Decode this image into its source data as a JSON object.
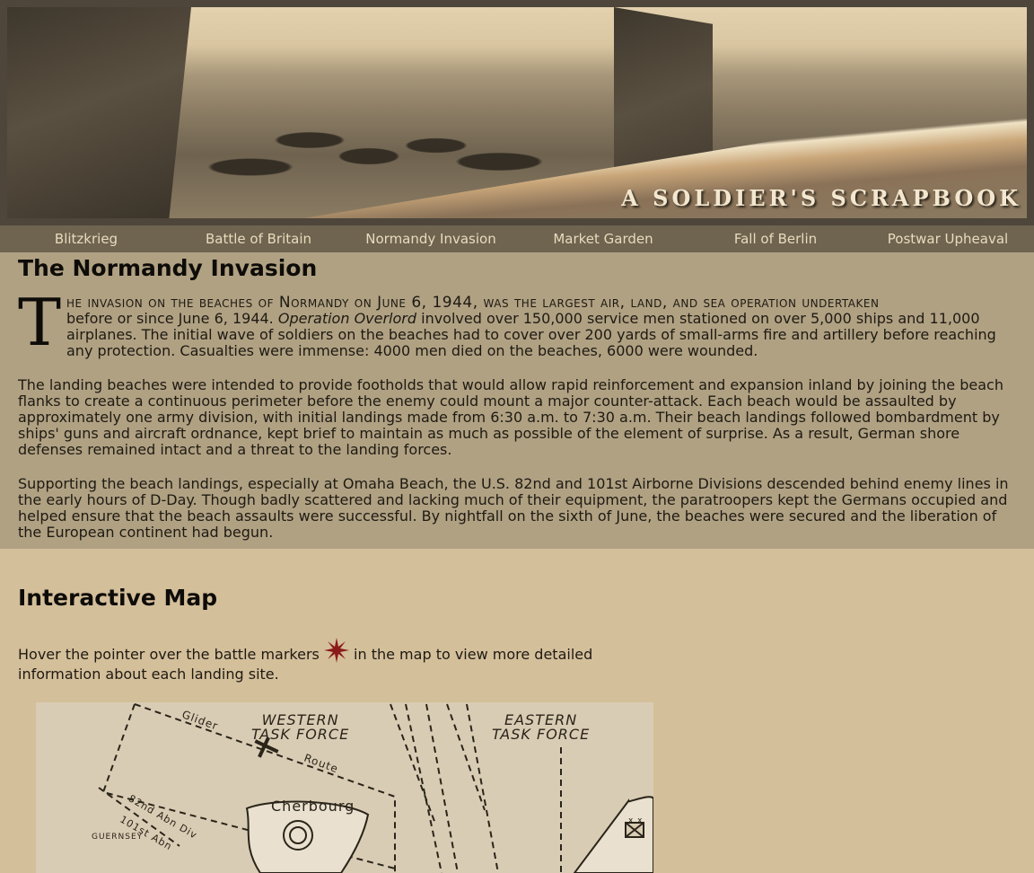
{
  "banner": {
    "title": "A SOLDIER'S SCRAPBOOK"
  },
  "nav": {
    "items": [
      {
        "label": "Blitzkrieg"
      },
      {
        "label": "Battle of Britain"
      },
      {
        "label": "Normandy Invasion"
      },
      {
        "label": "Market Garden"
      },
      {
        "label": "Fall of Berlin"
      },
      {
        "label": "Postwar Upheaval"
      }
    ]
  },
  "article": {
    "title": "The Normandy Invasion",
    "dropcap": "T",
    "lead_smallcaps": "he invasion on the beaches of Normandy on June 6, 1944, was the largest air, land, and sea operation undertaken",
    "lead_line2_pre": "before or since June 6, 1944. ",
    "lead_italic": "Operation Overlord",
    "lead_rest": " involved over 150,000 service men stationed on over 5,000 ships and 11,000 airplanes. The initial wave of soldiers on the beaches had to cover over 200 yards of small-arms fire and artillery before reaching any protection. Casualties were immense: 4000 men died on the beaches, 6000 were wounded.",
    "para2": "The landing beaches were intended to provide footholds that would allow rapid reinforcement and expansion inland by joining the beach flanks to create a continuous perimeter before the enemy could mount a major counter-attack. Each beach would be assaulted by approximately one army division, with initial landings made from 6:30 a.m. to 7:30 a.m. Their beach landings followed bombardment by ships' guns and aircraft ordnance, kept brief to maintain as much as possible of the element of surprise. As a result, German shore defenses remained intact and a threat to the landing forces.",
    "para3": "Supporting the beach landings, especially at Omaha Beach, the U.S. 82nd and 101st Airborne Divisions descended behind enemy lines in the early hours of D-Day. Though badly scattered and lacking much of their equipment, the paratroopers kept the Germans occupied and helped ensure that the beach assaults were successful. By nightfall on the sixth of June, the beaches were secured and the liberation of the European continent had begun."
  },
  "map_section": {
    "title": "Interactive Map",
    "hover_pre": "Hover the pointer over the battle markers ",
    "hover_post": " in the map to view more detailed information about each landing site.",
    "marker_color": "#8b1a1a"
  },
  "map": {
    "western_1": "WESTERN",
    "western_2": "TASK FORCE",
    "eastern_1": "EASTERN",
    "eastern_2": "TASK FORCE",
    "glider": "Glider",
    "route": "Route",
    "cherbourg": "Cherbourg",
    "div82": "82nd Abn Div",
    "div101": "101st Abn",
    "guernsey": "GUERNSEY",
    "xx": "x x"
  }
}
